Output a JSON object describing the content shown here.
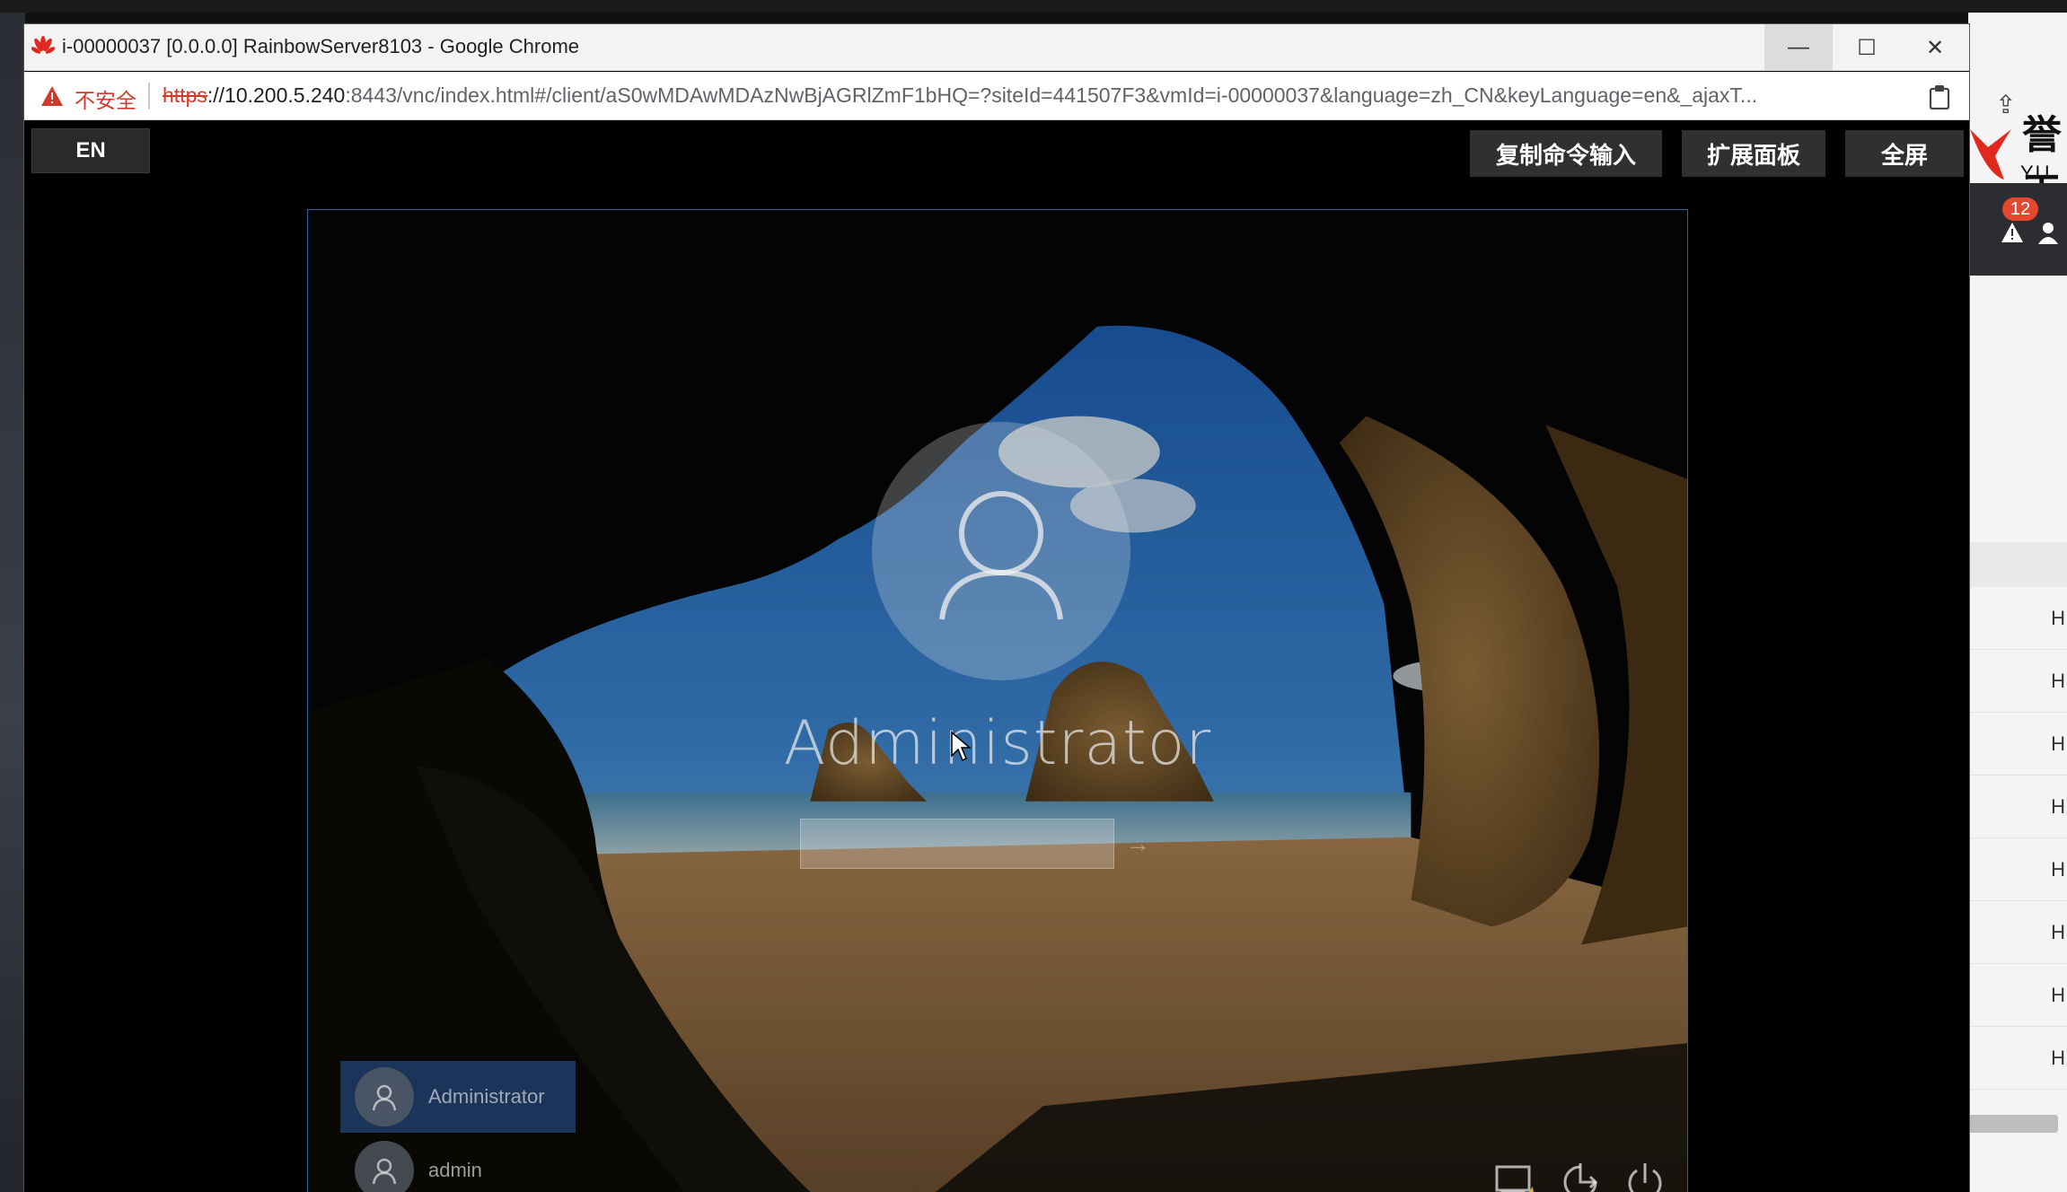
{
  "window": {
    "title": "i-00000037 [0.0.0.0] RainbowServer8103 - Google Chrome",
    "controls": {
      "minimize": "—",
      "maximize": "☐",
      "close": "✕"
    }
  },
  "address": {
    "security_label": "不安全",
    "url_scheme": "https",
    "url_host": "://10.200.5.240",
    "url_rest": ":8443/vnc/index.html#/client/aS0wMDAwMDAzNwBjAGRlZmF1bHQ=?siteId=441507F3&vmId=i-00000037&language=zh_CN&keyLanguage=en&_ajaxT..."
  },
  "toolbar": {
    "lang_label": "EN",
    "copy_label": "复制命令输入",
    "panel_label": "扩展面板",
    "fullscreen_label": "全屏"
  },
  "login": {
    "username": "Administrator",
    "users": [
      {
        "name": "Administrator",
        "selected": true
      },
      {
        "name": "admin",
        "selected": false
      }
    ]
  },
  "background_app": {
    "brand": "誉天",
    "brand_sub": "YU T",
    "alert_count": "12",
    "row_letter": "H"
  },
  "colors": {
    "accent_selected_user": "#2a5aa0",
    "insecure_red": "#d13a2a",
    "screen_border": "#1f6a9a",
    "badge_red": "#e5482f"
  }
}
